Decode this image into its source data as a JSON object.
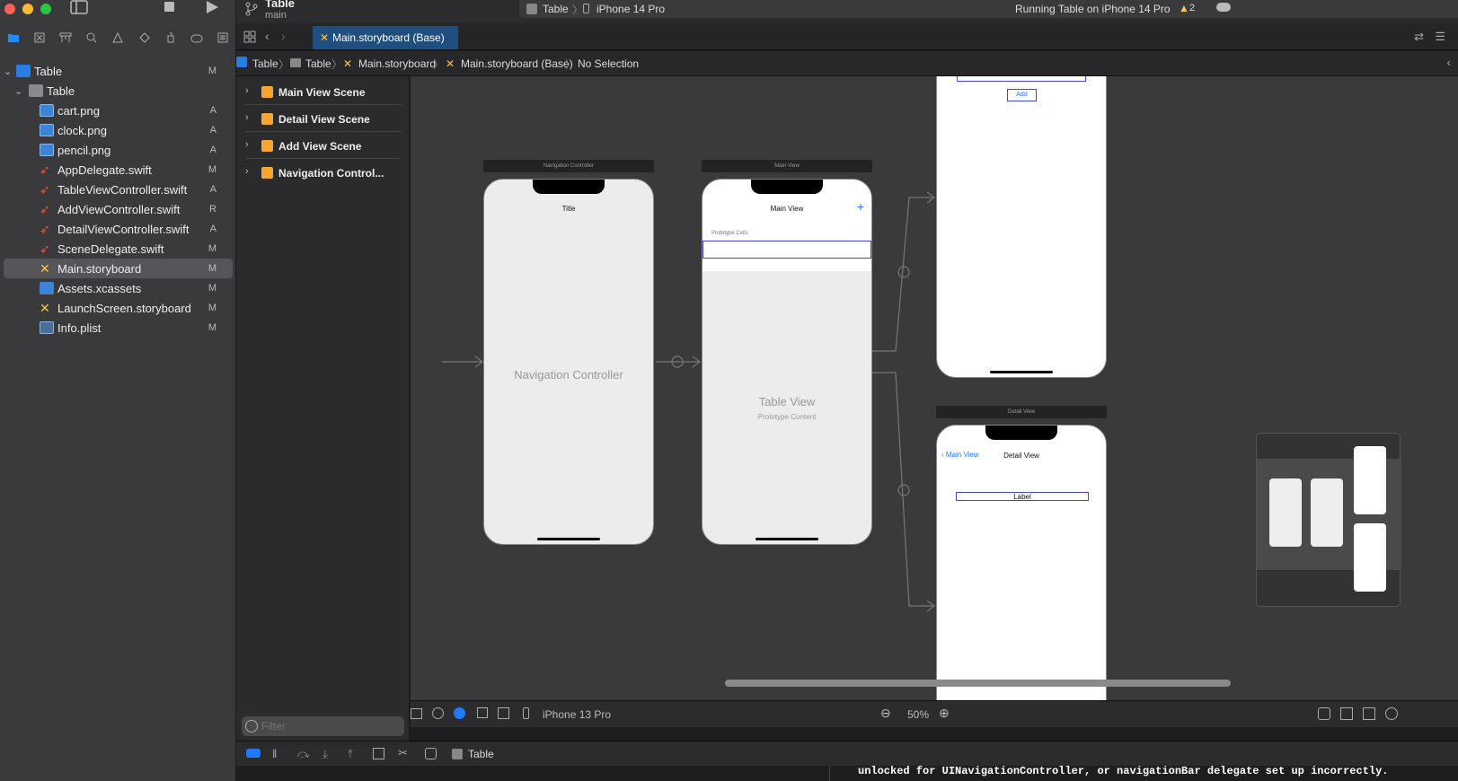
{
  "project_navigator": {
    "tabs": [
      "folder-icon",
      "x-square-icon",
      "hierarchy-icon",
      "search-icon",
      "warning-icon",
      "diamond-icon",
      "spray-icon",
      "tag-icon",
      "list-icon"
    ],
    "items": [
      {
        "name": "Table",
        "status": "M",
        "type": "project",
        "level": 0,
        "expanded": true
      },
      {
        "name": "Table",
        "status": "",
        "type": "folder",
        "level": 1,
        "expanded": true
      },
      {
        "name": "cart.png",
        "status": "A",
        "type": "image",
        "level": 2
      },
      {
        "name": "clock.png",
        "status": "A",
        "type": "image",
        "level": 2
      },
      {
        "name": "pencil.png",
        "status": "A",
        "type": "image",
        "level": 2
      },
      {
        "name": "AppDelegate.swift",
        "status": "M",
        "type": "swift",
        "level": 2
      },
      {
        "name": "TableViewController.swift",
        "status": "A",
        "type": "swift",
        "level": 2
      },
      {
        "name": "AddViewController.swift",
        "status": "R",
        "type": "swift",
        "level": 2
      },
      {
        "name": "DetailViewController.swift",
        "status": "A",
        "type": "swift",
        "level": 2
      },
      {
        "name": "SceneDelegate.swift",
        "status": "M",
        "type": "swift",
        "level": 2
      },
      {
        "name": "Main.storyboard",
        "status": "M",
        "type": "storyboard",
        "level": 2,
        "selected": true
      },
      {
        "name": "Assets.xcassets",
        "status": "M",
        "type": "assets",
        "level": 2
      },
      {
        "name": "LaunchScreen.storyboard",
        "status": "M",
        "type": "storyboard",
        "level": 2
      },
      {
        "name": "Info.plist",
        "status": "M",
        "type": "plist",
        "level": 2
      }
    ]
  },
  "toolbar": {
    "project_name": "Table",
    "branch": "main",
    "scheme": "Table",
    "device": "iPhone 14 Pro",
    "status": "Running Table on iPhone 14 Pro",
    "warnings": "2"
  },
  "editor_tab": {
    "label": "Main.storyboard (Base)"
  },
  "jump_bar": [
    "Table",
    "Table",
    "Main.storyboard",
    "Main.storyboard (Base)",
    "No Selection"
  ],
  "outline": [
    "Main View Scene",
    "Detail View Scene",
    "Add View  Scene",
    "Navigation Control..."
  ],
  "canvas": {
    "nav_controller": {
      "header": "Navigation Controller",
      "title": "Title",
      "body": "Navigation Controller"
    },
    "main_view": {
      "header": "Main View",
      "title": "Main View",
      "add": "+",
      "section": "Prototype Cells",
      "table_title": "Table View",
      "table_sub": "Prototype Content"
    },
    "add_view": {
      "button": "Add"
    },
    "detail_view": {
      "header": "Detail View",
      "back": "Main View",
      "title": "Detail View",
      "label": "Label"
    }
  },
  "filter": {
    "placeholder": "Filter"
  },
  "canvas_bar": {
    "device": "iPhone 13 Pro",
    "zoom": "50%"
  },
  "debug_bar": {
    "target": "Table"
  },
  "console": {
    "line": "unlocked for UINavigationController, or navigationBar delegate set up incorrectly."
  }
}
